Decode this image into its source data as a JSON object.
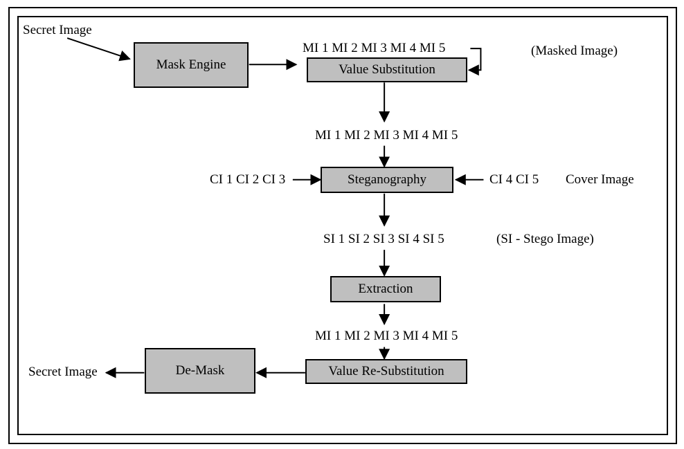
{
  "labels": {
    "secret_image_in": "Secret Image",
    "secret_image_out": "Secret Image",
    "masked_image": "(Masked Image)",
    "cover_image": "Cover Image",
    "stego_image": "(SI - Stego Image)"
  },
  "sequences": {
    "mi_top": "MI 1  MI 2  MI 3  MI 4  MI 5",
    "mi_mid": "MI 1  MI 2  MI 3  MI 4  MI 5",
    "mi_bottom": "MI 1  MI 2  MI 3  MI 4  MI 5",
    "ci_left": "CI 1  CI 2  CI 3",
    "ci_right": "CI 4  CI 5",
    "si": "SI 1  SI 2  SI 3  SI 4  SI 5"
  },
  "boxes": {
    "mask_engine": "Mask Engine",
    "value_substitution": "Value Substitution",
    "steganography": "Steganography",
    "extraction": "Extraction",
    "value_re_substitution": "Value Re-Substitution",
    "de_mask": "De-Mask"
  }
}
